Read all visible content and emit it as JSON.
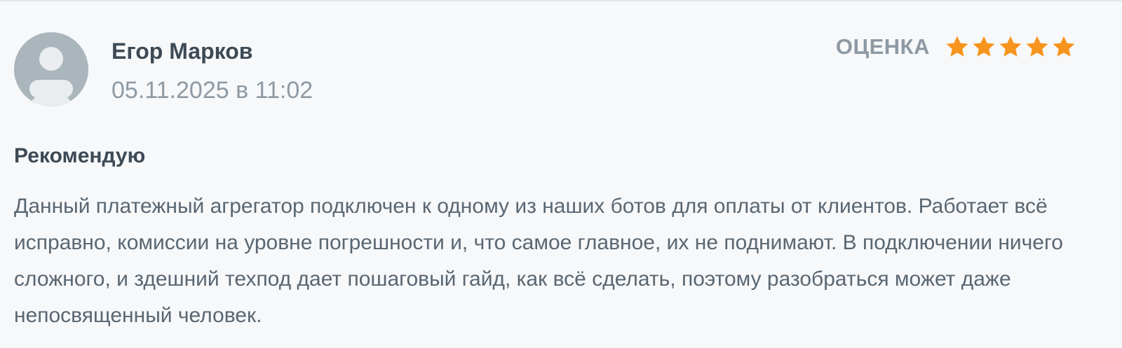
{
  "review": {
    "author": "Егор Марков",
    "date": "05.11.2025 в 11:02",
    "rating_label": "ОЦЕНКА",
    "rating": 5,
    "rating_max": 5,
    "title": "Рекомендую",
    "text": "Данный платежный агрегатор подключен к одному из наших ботов для оплаты от клиентов. Работает всё исправно, комиссии на уровне погрешности и, что самое главное, их не поднимают. В подключении ничего сложного, и здешний техпод дает пошаговый гайд, как всё сделать, поэтому разобраться может даже непосвященный человек."
  },
  "icons": {
    "avatar": "user-placeholder-icon",
    "star": "star-icon"
  },
  "colors": {
    "star_filled": "#f7941d",
    "avatar_bg": "#aab5bc",
    "card_bg": "#f6f8fa"
  }
}
